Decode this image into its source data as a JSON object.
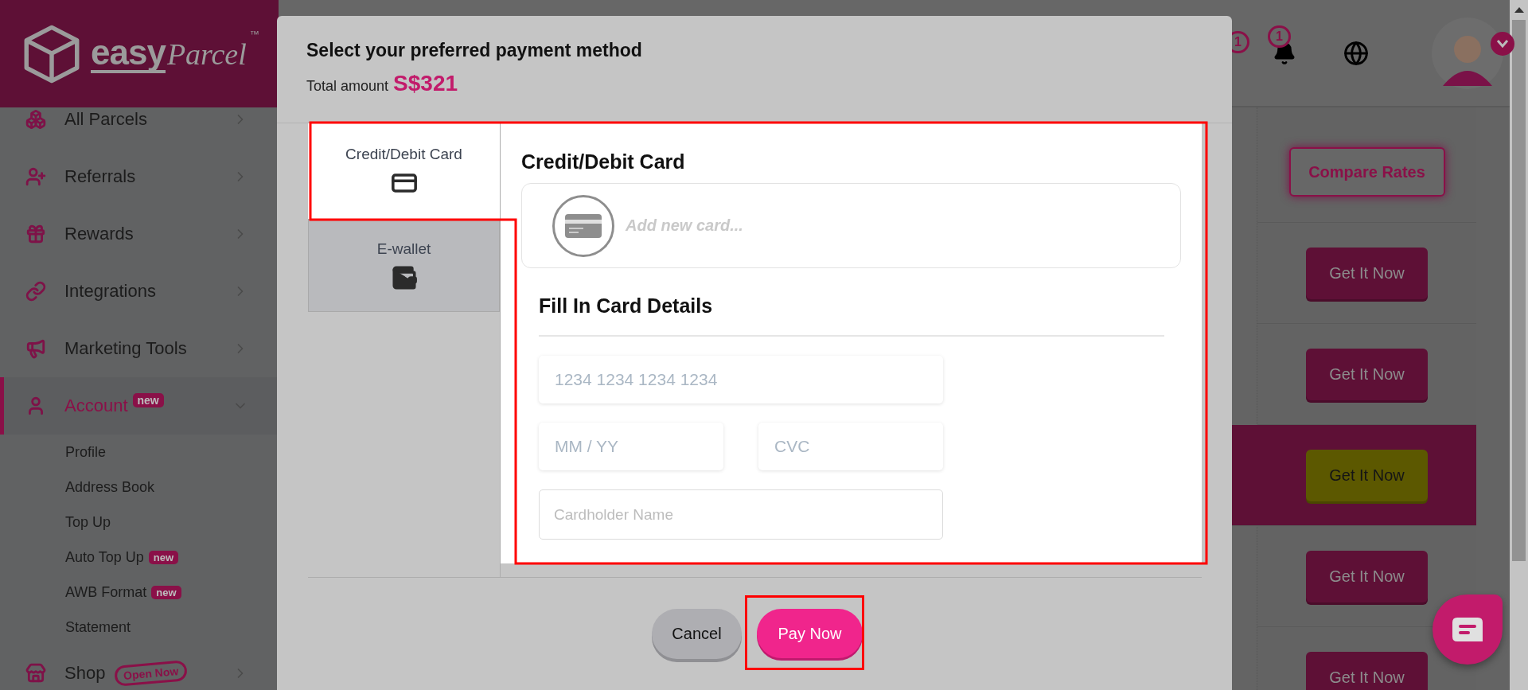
{
  "logo": {
    "brand": "easy",
    "script": "Parcel",
    "trademark": "™"
  },
  "sidebar": {
    "items": [
      {
        "label": "All Parcels",
        "expanded": false,
        "selected": false
      },
      {
        "label": "Referrals",
        "expanded": false,
        "selected": false
      },
      {
        "label": "Rewards",
        "expanded": false,
        "selected": false
      },
      {
        "label": "Integrations",
        "expanded": false,
        "selected": false
      },
      {
        "label": "Marketing Tools",
        "expanded": false,
        "selected": false
      },
      {
        "label": "Account",
        "badge": "new",
        "expanded": true,
        "selected": true,
        "children": [
          {
            "label": "Profile"
          },
          {
            "label": "Address Book"
          },
          {
            "label": "Top Up"
          },
          {
            "label": "Auto Top Up",
            "badge": "new"
          },
          {
            "label": "AWB Format",
            "badge": "new"
          },
          {
            "label": "Statement"
          }
        ]
      },
      {
        "label": "Shop",
        "tag": "Open Now",
        "expanded": false,
        "selected": false
      }
    ]
  },
  "header": {
    "notification_counts": [
      "1",
      "1"
    ]
  },
  "rates": {
    "compare_button": "Compare Rates",
    "rows": [
      {
        "button": "Get It Now",
        "selected": false
      },
      {
        "button": "Get It Now",
        "selected": false
      },
      {
        "button": "Get It Now",
        "selected": true
      },
      {
        "button": "Get It Now",
        "selected": false
      },
      {
        "button": "Get It Now",
        "selected": false
      }
    ]
  },
  "modal": {
    "title": "Select your preferred payment method",
    "total_label": "Total amount",
    "total_value": "S$321",
    "tabs": [
      {
        "label": "Credit/Debit Card",
        "selected": true
      },
      {
        "label": "E-wallet",
        "selected": false
      }
    ],
    "panel_title": "Credit/Debit Card",
    "saved_card": {
      "placeholder": "Add new card..."
    },
    "details_title": "Fill In Card Details",
    "fields": {
      "card_number": {
        "placeholder": "1234 1234 1234 1234"
      },
      "expiry": {
        "placeholder": "MM / YY"
      },
      "cvc": {
        "placeholder": "CVC"
      },
      "cardholder": {
        "placeholder": "Cardholder Name"
      }
    },
    "buttons": {
      "cancel": "Cancel",
      "pay": "Pay Now"
    }
  }
}
